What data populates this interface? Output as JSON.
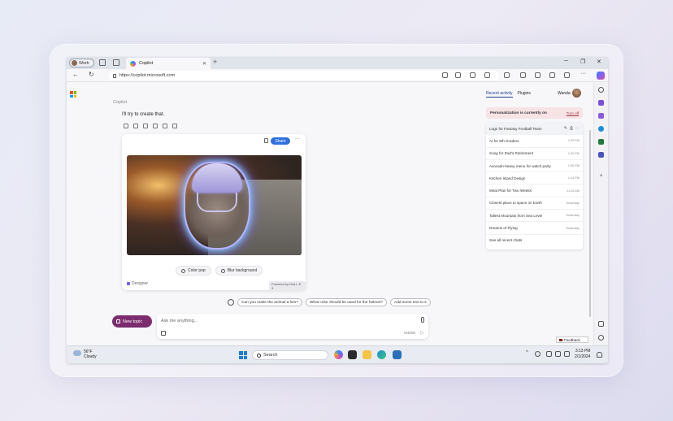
{
  "browser": {
    "profile_label": "Work",
    "tab_title": "Copilot",
    "tab_close": "✕",
    "new_tab": "+",
    "url": "https://copilot.microsoft.com",
    "window_controls": [
      "─",
      "❐",
      "✕"
    ],
    "nav_icons": [
      "←",
      "↻"
    ]
  },
  "chat": {
    "copilot_label": "Copilot",
    "reply_text": "I'll try to create that.",
    "share_label": "Share",
    "more_label": "···",
    "image_actions": [
      "Color pop",
      "Blur background"
    ],
    "designer_label": "Designer",
    "powered_by": "Powered by DALL·E 3",
    "suggestions": [
      "Can you make the animal a lion?",
      "What color should be used for the helmet?",
      "Add some text to it"
    ],
    "new_topic_label": "New topic",
    "compose_placeholder": "Ask me anything...",
    "char_count": "0/4000",
    "send_glyph": "▷"
  },
  "panel": {
    "tabs": [
      "Recent activity",
      "Plugins"
    ],
    "user_name": "Wanda",
    "personalization_text": "Personalization is currently on",
    "personalization_link": "Turn off",
    "recent": [
      {
        "title": "Logo for Fantasy Football Team",
        "time": ""
      },
      {
        "title": "AI for 6th Graders",
        "time": "1:25 PM"
      },
      {
        "title": "Song for Dad's Retirement",
        "time": "1:20 PM"
      },
      {
        "title": "Avocado-heavy menu for watch party",
        "time": "1:05 PM"
      },
      {
        "title": "Kitchen Island Design",
        "time": "1:14 PM"
      },
      {
        "title": "Meal Plan for Two Weeks",
        "time": "11:22 AM"
      },
      {
        "title": "Closest place to space on Earth",
        "time": "Yesterday"
      },
      {
        "title": "Tallest Mountain from Sea Level",
        "time": "Yesterday"
      },
      {
        "title": "Dreams of Flying",
        "time": "Yesterday"
      }
    ],
    "item_icons": [
      "✎",
      "⎙",
      "···"
    ],
    "see_all": "See all recent chats",
    "feedback": "Feedback"
  },
  "taskbar": {
    "temperature": "56°F",
    "condition": "Cloudy",
    "search_label": "Search",
    "time": "3:13 PM",
    "date": "2/1/2024",
    "tray_chevron": "^"
  },
  "colors": {
    "accent": "#2f6fe0",
    "new_topic": "#7b2d6e",
    "personalization_bg": "#f7e3e6"
  }
}
